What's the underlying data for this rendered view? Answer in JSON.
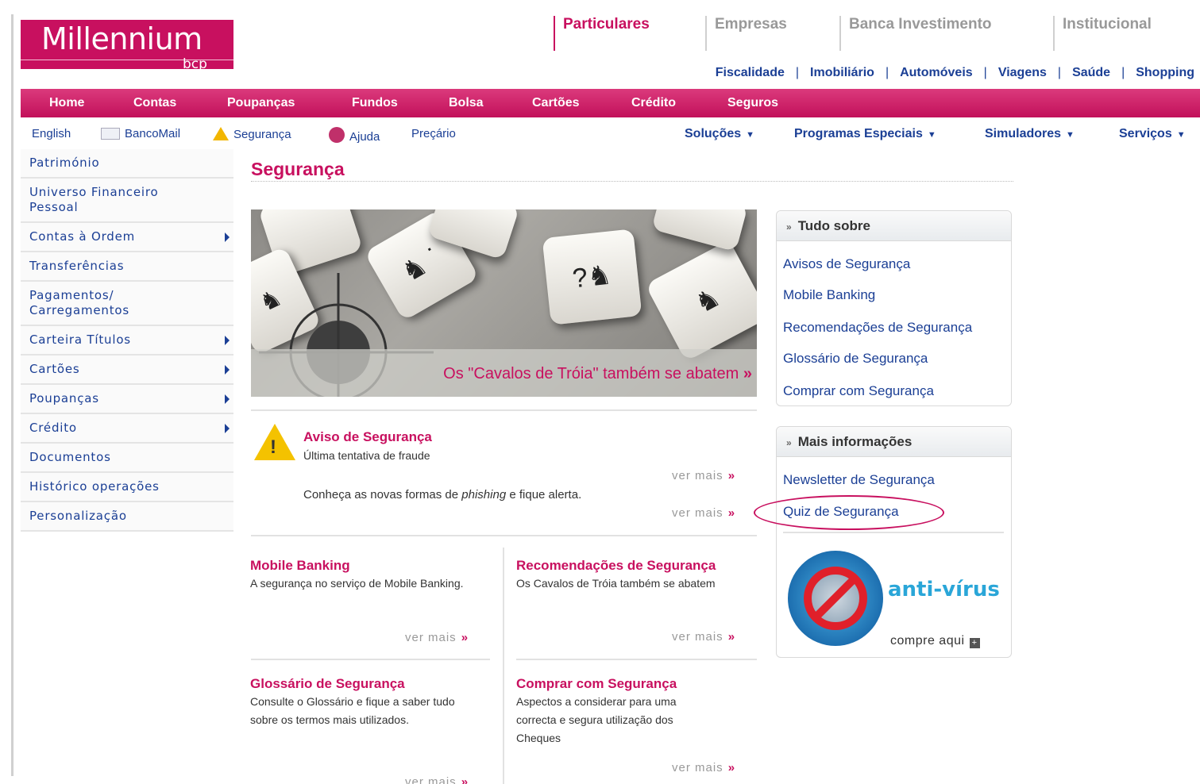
{
  "logo": {
    "name": "Millennium",
    "sub": "bcp"
  },
  "segments": [
    "Particulares",
    "Empresas",
    "Banca Investimento",
    "Institucional"
  ],
  "subnav": [
    "Fiscalidade",
    "Imobiliário",
    "Automóveis",
    "Viagens",
    "Saúde",
    "Shopping"
  ],
  "navbar": [
    "Home",
    "Contas",
    "Poupanças",
    "Fundos",
    "Bolsa",
    "Cartões",
    "Crédito",
    "Seguros"
  ],
  "utility": {
    "english": "English",
    "bancomail": "BancoMail",
    "seguranca": "Segurança",
    "ajuda": "Ajuda",
    "preçario": "Preçário"
  },
  "menus": [
    "Soluções",
    "Programas Especiais",
    "Simuladores",
    "Serviços"
  ],
  "sidebar": [
    "Património",
    "Universo Financeiro Pessoal",
    "Contas à Ordem",
    "Transferências",
    "Pagamentos/ Carregamentos",
    "Carteira Títulos",
    "Cartões",
    "Poupanças",
    "Crédito",
    "Documentos",
    "Histórico operações",
    "Personalização"
  ],
  "page_title": "Segurança",
  "banner": {
    "text": "Os \"Cavalos de Tróia\" também se abatem",
    "raquo": "»"
  },
  "aviso": {
    "title": "Aviso de Segurança",
    "subtitle": "Última tentativa de fraude",
    "text_before": "Conheça as novas formas de ",
    "text_em": "phishing",
    "text_after": " e fique alerta."
  },
  "ver_mais": "ver mais",
  "raquo": "»",
  "cards": [
    {
      "title": "Mobile Banking",
      "text": "A segurança no serviço de Mobile Banking."
    },
    {
      "title": "Recomendações de Segurança",
      "text": "Os Cavalos de Tróia também se abatem"
    },
    {
      "title": "Glossário de Segurança",
      "text": "Consulte o Glossário e fique a saber tudo sobre os termos mais utilizados."
    },
    {
      "title": "Comprar com Segurança",
      "text": "Aspectos a considerar para uma correcta e segura utilização dos Cheques"
    }
  ],
  "tudo_sobre": {
    "title": "Tudo sobre",
    "links": [
      "Avisos de Segurança",
      "Mobile Banking",
      "Recomendações de Segurança",
      "Glossário de Segurança",
      "Comprar com Segurança"
    ]
  },
  "mais_info": {
    "title": "Mais informações",
    "links": [
      "Newsletter de Segurança",
      "Quiz de Segurança"
    ]
  },
  "antivirus": {
    "label": "anti-vírus",
    "cta": "compre aqui"
  },
  "colors": {
    "brand": "#c8105f",
    "link": "#1b3f95"
  }
}
